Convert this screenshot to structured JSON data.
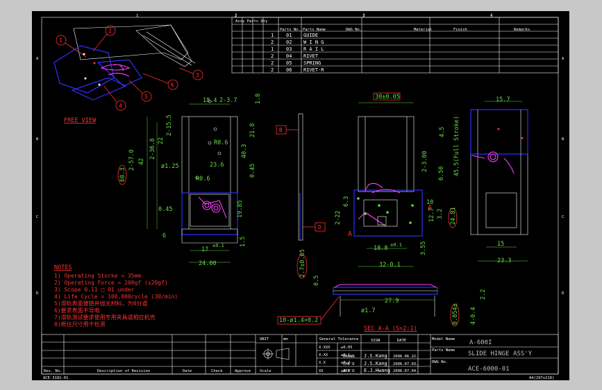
{
  "colors": {
    "background": "#000000",
    "frame": "#ffffff",
    "dimension": "#66dd44",
    "spring": "#ff40ff",
    "body": "#3030ff",
    "callout": "#ff3030"
  },
  "grid": {
    "top_cols": [
      "1",
      "2",
      "3",
      "4"
    ],
    "rows": [
      "A",
      "B",
      "C",
      "D"
    ]
  },
  "parts_table": {
    "headers": [
      "Assy Parts Qty",
      "Parts No.",
      "Parts Name",
      "DWG No.",
      "Material",
      "Finish",
      "Remarks"
    ],
    "rows": [
      {
        "qty": "1",
        "no": "01",
        "name": "GUIDE"
      },
      {
        "qty": "2",
        "no": "02",
        "name": "W I N G"
      },
      {
        "qty": "1",
        "no": "03",
        "name": "R A I L"
      },
      {
        "qty": "2",
        "no": "04",
        "name": "RIVET"
      },
      {
        "qty": "2",
        "no": "05",
        "name": "SPRING"
      },
      {
        "qty": "2",
        "no": "06",
        "name": "RIVET-R"
      }
    ]
  },
  "balloons": [
    "1",
    "2",
    "3",
    "4",
    "5",
    "6"
  ],
  "free_view": "FREE VIEW",
  "dims_front": [
    "18.4",
    "2-3.7",
    "1.8",
    "2-15.5",
    "22",
    "2-36.8",
    "42",
    "2-57.0",
    "60.3",
    "ø1.25",
    "R0.6",
    "23.6",
    "R0.6",
    "21.8",
    "40.3",
    "0.45",
    "0.45",
    "19.85",
    "1.5",
    "6",
    "17",
    "24.00"
  ],
  "dim_tol": "±0.1",
  "section_marks": {
    "b": "B",
    "d": "D",
    "a": "A"
  },
  "dims_section": [
    "30±0.05",
    "2-3.00",
    "45.5(Full Stroke)",
    "4.5",
    "6.50",
    "2-22",
    "6.3",
    "3.2",
    "12.7",
    "24.81",
    "18.8",
    "32-0.1",
    "3.55",
    "10"
  ],
  "dims_right": [
    "15.7",
    "15",
    "23.3"
  ],
  "dims_bottom": [
    "2.7±0.05",
    "0.5",
    "27.9",
    "ø1.7",
    "0.854±",
    "4-0.4",
    "2.2"
  ],
  "callout_note": "10-ø1.4×0.2",
  "sec_label": "SEC A-A (S=2:1)",
  "notes_title": "NOTES",
  "notes": [
    "1) Operating Storke = 35mm",
    "2) Operating Force = 200gf (±20gf)",
    "3) Scope 0.11  □ 01 under",
    "4) Life Cycle = 100,000cycle (30/min)",
    "5)滑轨表面镀铬并抛光材料，为8分道",
    "6)要求表面不导电",
    "7)滑轨测试要求使用专用夹具或相应机壳",
    "8)框住尺寸用干检测"
  ],
  "title_block": {
    "revision_headers": [
      "Rev. No.",
      "Description of Revision",
      "Date",
      "Check",
      "Approve"
    ],
    "unit_label": "UNIT",
    "unit_value": "mm",
    "tolerance_title": "General Tolerance",
    "tolerances": [
      {
        "fmt": "X.XXX",
        "val": "±0.05"
      },
      {
        "fmt": "X.XX",
        "val": "±0.1"
      },
      {
        "fmt": "X.X",
        "val": "±0.2"
      },
      {
        "fmt": "XX",
        "val": "±0.3"
      }
    ],
    "scale_label": "Scale",
    "sign_headers": [
      "SIGN",
      "DATE"
    ],
    "signs": [
      {
        "role": "DRAWN",
        "name": "J.S.Kang",
        "date": "2006.06.22."
      },
      {
        "role": "CHK'D",
        "name": "J.S.Kang",
        "date": "2006.07.03."
      },
      {
        "role": "APP'D",
        "name": "E.J.Hwang",
        "date": "2006.07.04."
      }
    ],
    "model_label": "Model Name",
    "model_value": "A-600I",
    "parts_label": "Parts Name",
    "parts_value": "SLIDE HINGE ASS'Y",
    "dwg_label": "DWG No.",
    "dwg_value": "ACE-6000-01"
  },
  "footer_left": "ACE-3181-01",
  "footer_right": "A4(297x210)"
}
